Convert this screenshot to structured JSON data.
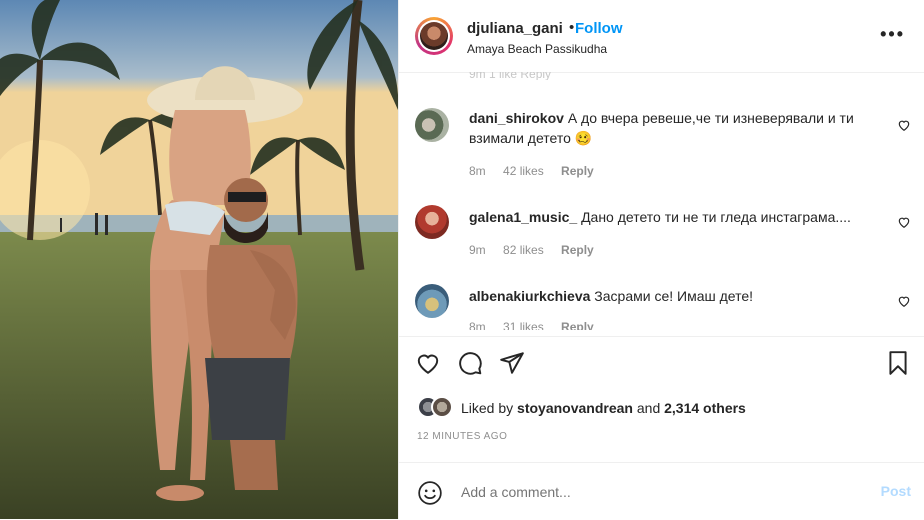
{
  "post": {
    "username": "djuliana_gani",
    "separator": "•",
    "follow_label": "Follow",
    "location": "Amaya Beach Passikudha",
    "more_icon": "more-horizontal-icon"
  },
  "ghost_meta": "9m  1 like  Reply",
  "comments": [
    {
      "username": "dani_shirokov",
      "text": "А до вчера ревеше,че ти изневерявали и ти взимали детето 🥴",
      "time": "8m",
      "likes": "42 likes",
      "reply": "Reply"
    },
    {
      "username": "galena1_music_",
      "text": "Дано детето ти не ти гледа инстаграма....",
      "time": "9m",
      "likes": "82 likes",
      "reply": "Reply"
    },
    {
      "username": "albenakiurkchieva",
      "text": "Засрами се! Имаш дете!",
      "time": "8m",
      "likes": "31 likes",
      "reply": "Reply"
    }
  ],
  "liked_by": {
    "prefix": "Liked by",
    "user": "stoyanovandrean",
    "conjunction": "and",
    "count": "2,314 others"
  },
  "timestamp": "12 MINUTES AGO",
  "add_comment": {
    "placeholder": "Add a comment...",
    "post_label": "Post"
  },
  "colors": {
    "accent": "#0095f6",
    "post_disabled": "#b3dbff",
    "muted": "#8e8e8e"
  }
}
